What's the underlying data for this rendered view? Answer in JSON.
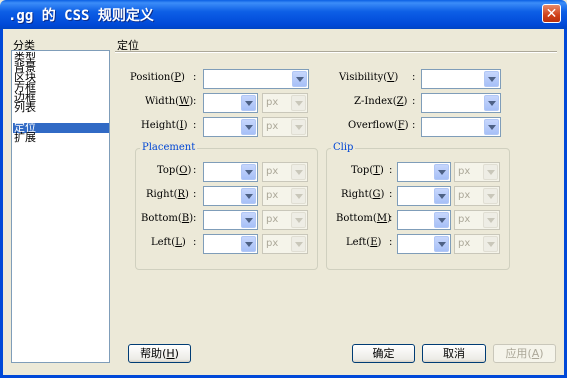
{
  "window": {
    "title": ".gg 的 CSS 规则定义",
    "close_glyph": "✕"
  },
  "category": {
    "label": "分类",
    "items": [
      "类型",
      "背景",
      "区块",
      "方框",
      "边框",
      "列表",
      "定位",
      "扩展"
    ],
    "selected": "定位"
  },
  "section_title": "定位",
  "fields": {
    "position": {
      "label": "Position",
      "key": "P"
    },
    "width": {
      "label": "Width",
      "key": "W",
      "unit": "px"
    },
    "height": {
      "label": "Height",
      "key": "I",
      "unit": "px"
    },
    "visibility": {
      "label": "Visibility",
      "key": "V"
    },
    "zindex": {
      "label": "Z-Index",
      "key": "Z"
    },
    "overflow": {
      "label": "Overflow",
      "key": "F"
    }
  },
  "placement": {
    "title": "Placement",
    "top": {
      "label": "Top",
      "key": "O",
      "unit": "px"
    },
    "right": {
      "label": "Right",
      "key": "R",
      "unit": "px"
    },
    "bottom": {
      "label": "Bottom",
      "key": "B",
      "unit": "px"
    },
    "left": {
      "label": "Left",
      "key": "L",
      "unit": "px"
    }
  },
  "clip": {
    "title": "Clip",
    "top": {
      "label": "Top",
      "key": "T",
      "unit": "px"
    },
    "right": {
      "label": "Right",
      "key": "G",
      "unit": "px"
    },
    "bottom": {
      "label": "Bottom",
      "key": "M",
      "unit": "px"
    },
    "left": {
      "label": "Left",
      "key": "E",
      "unit": "px"
    }
  },
  "colon": ":",
  "buttons": {
    "help": {
      "label": "帮助",
      "key": "H"
    },
    "ok": "确定",
    "cancel": "取消",
    "apply": {
      "label": "应用",
      "key": "A"
    }
  }
}
